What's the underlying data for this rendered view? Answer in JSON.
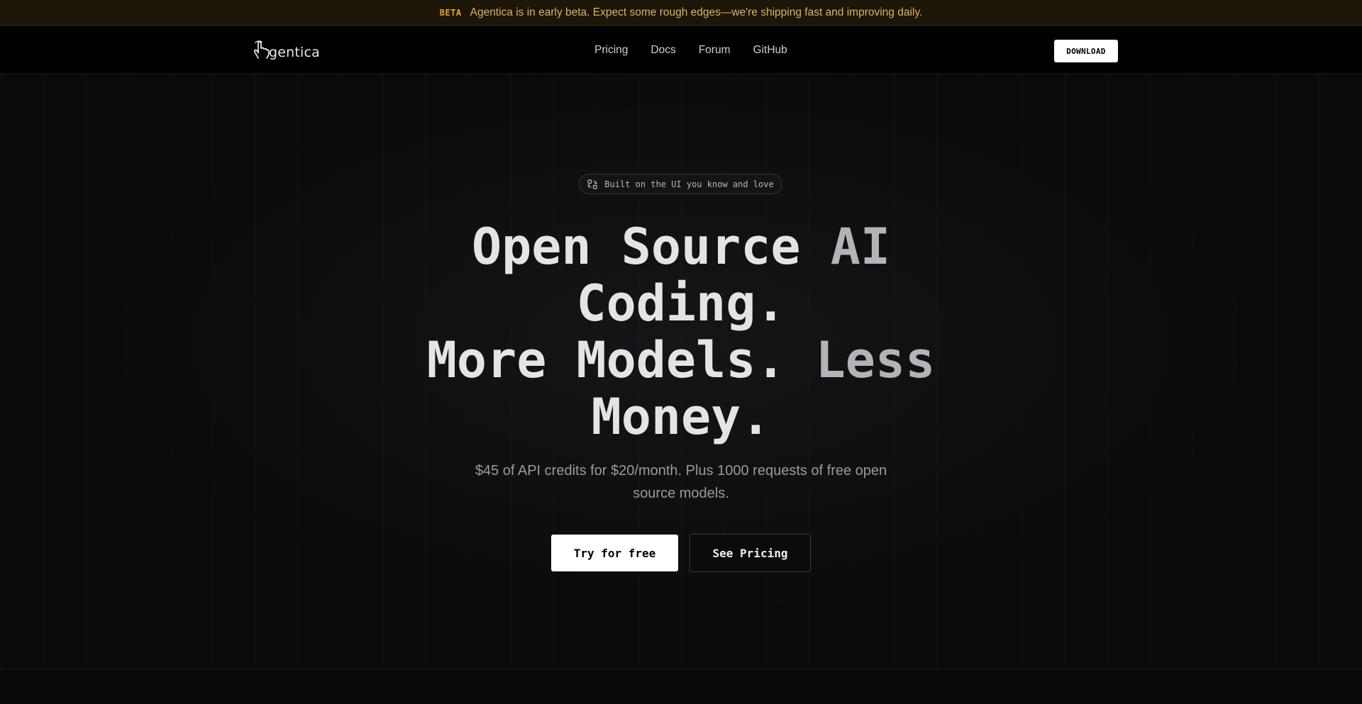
{
  "banner": {
    "badge": "BETA",
    "message": "Agentica is in early beta. Expect some rough edges—we're shipping fast and improving daily.",
    "badge_color": "#e0a62b",
    "message_color": "#d9b36a"
  },
  "nav": {
    "logo_text": "gentica",
    "links": [
      "Pricing",
      "Docs",
      "Forum",
      "GitHub"
    ],
    "download_label": "DOWNLOAD",
    "logo_icon": "hand-pointer-icon"
  },
  "hero": {
    "pill_icon": "code-diff-icon",
    "pill_text": "Built on the UI you know and love",
    "headline": {
      "line1_a": "Open Source ",
      "line1_b": "AI",
      "line2": "Coding.",
      "line3_a": "More Models. ",
      "line3_b": "Less",
      "line4": "Money."
    },
    "subtext": "$45 of API credits for $20/month. Plus 1000 requests of free open source models.",
    "primary_button": "Try for free",
    "secondary_button": "See Pricing"
  }
}
